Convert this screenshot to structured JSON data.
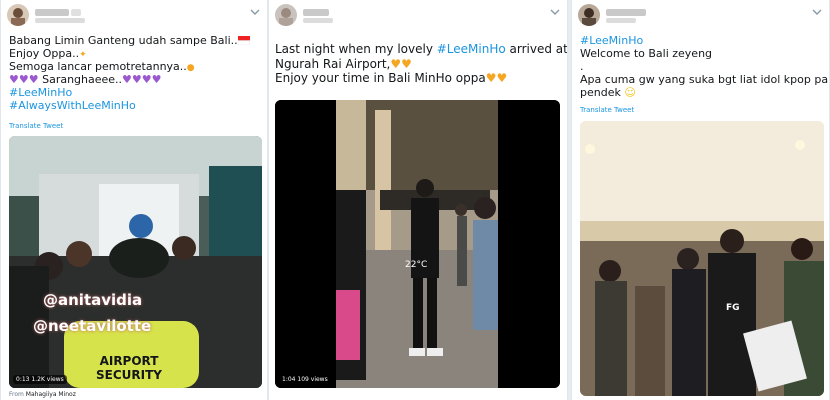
{
  "tweets": [
    {
      "lines": [
        "Babang Limin Ganteng udah sampe Bali..",
        "Enjoy Oppa..",
        "Semoga lancar pemotretannya..",
        "Saranghaeee.."
      ],
      "hashtags": [
        "#LeeMinHo",
        "#AlwaysWithLeeMinHo"
      ],
      "translate": "Translate Tweet",
      "video": {
        "duration": "0:13",
        "views": "1.2K views",
        "overlay_tags": [
          "@anitavidia",
          "@neetavilotte"
        ],
        "vest_text": "AIRPORT SECURITY"
      },
      "from_label": "From",
      "from_user": "Mahagiiya Minoz"
    },
    {
      "line1_prefix": "Last night when my lovely ",
      "line1_hashtag": "#LeeMinHo",
      "line1_suffix": " arrived at",
      "line2": "Ngurah Rai Airport,",
      "line3": "Enjoy your time in Bali MinHo oppa",
      "video": {
        "duration": "1:04",
        "views": "109 views",
        "temperature": "22°C"
      }
    },
    {
      "hashtag": "#LeeMinHo",
      "lines": [
        "Welcome to Bali zeyeng",
        ".",
        "Apa cuma gw yang suka bgt liat idol kpop pake celana",
        "pendek"
      ],
      "translate": "Translate Tweet",
      "photo": {
        "shirt_text": "FG"
      }
    }
  ],
  "colors": {
    "link": "#1b95e0",
    "text": "#14171a",
    "background": "#e6ecf0"
  },
  "icons": [
    "chevron-down-icon",
    "hibiscus-flag-icon",
    "purple-heart-icon",
    "orange-heart-icon",
    "grin-icon"
  ]
}
